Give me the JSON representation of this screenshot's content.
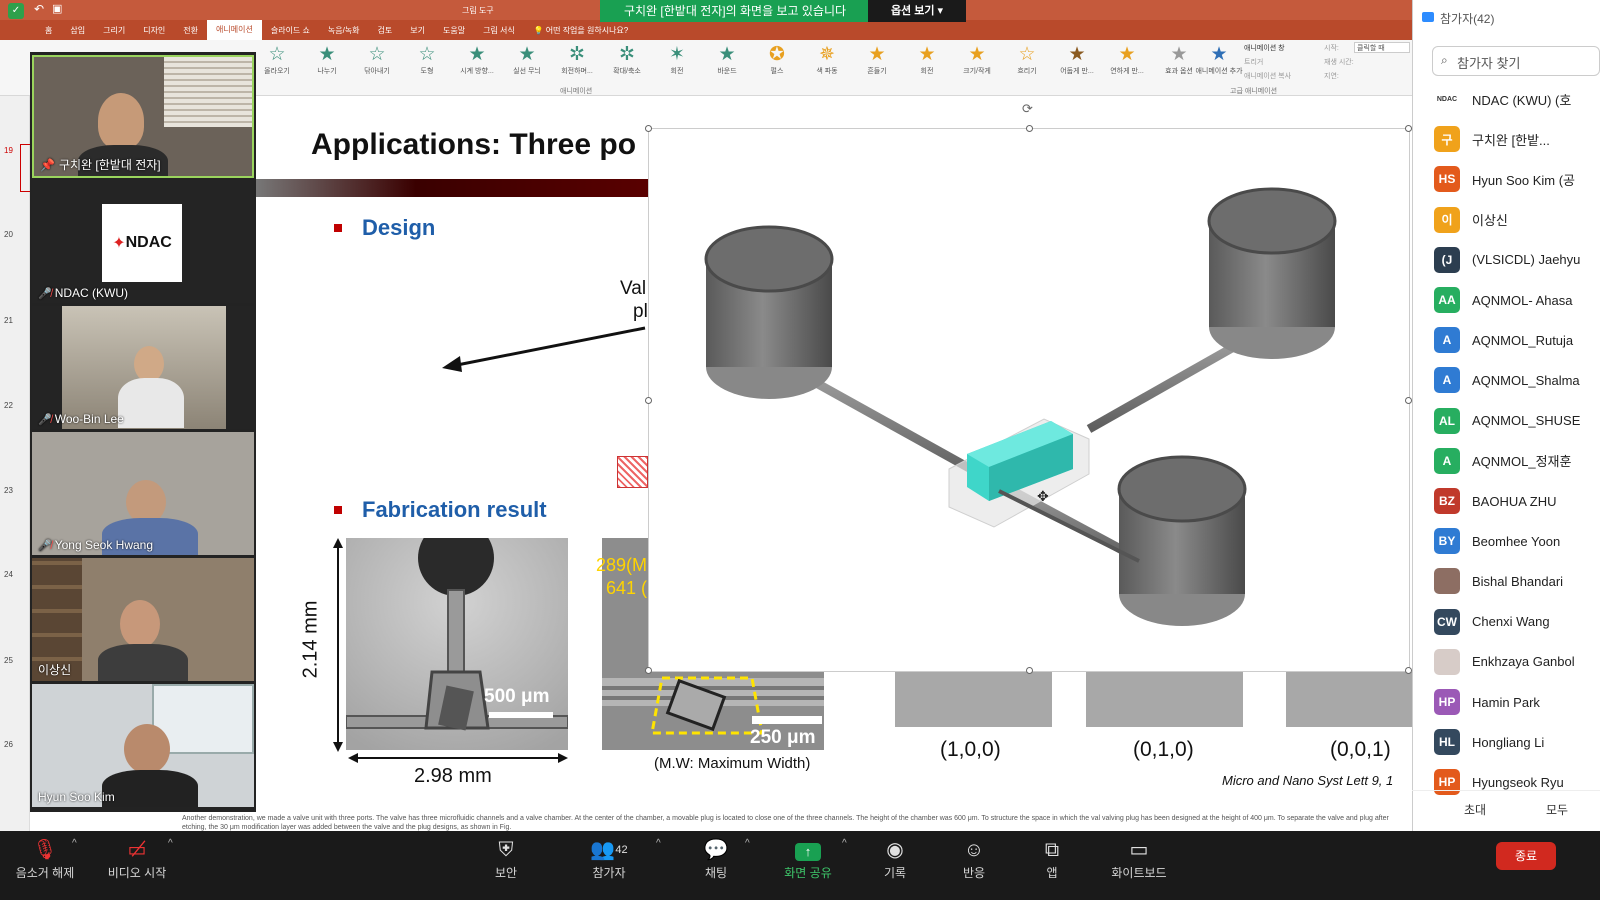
{
  "banner": {
    "sharing": "구치완 [한밭대 전자]의 화면을 보고 있습니다",
    "view_options": "옵션 보기"
  },
  "ribbon": {
    "tabs": [
      "홈",
      "삽입",
      "그리기",
      "디자인",
      "전환",
      "애니메이션",
      "슬라이드 쇼",
      "녹음/녹화",
      "검토",
      "보기",
      "도움말",
      "그림 서식"
    ],
    "active_tab": "애니메이션",
    "tell_me": "어떤 작업을 원하시나요?",
    "tools_label": "그림 도구",
    "effects": [
      "올라오기",
      "나누기",
      "닦아내기",
      "도형",
      "시계 방향...",
      "실선 무늬",
      "회전하며...",
      "확대/축소",
      "회전",
      "바운드",
      "펄스",
      "색 파동",
      "흔들기",
      "회전",
      "크기/작게",
      "흐리기",
      "어둡게 만...",
      "연하게 만...",
      "효과 옵션"
    ],
    "group_caption": "애니메이션",
    "advanced_caption": "고급 애니메이션",
    "add_anim": "애니메이션 추가",
    "anim_pane": "애니메이션 창",
    "trigger": "트리거",
    "anim_painter": "애니메이션 복사",
    "start": "시작:",
    "duration": "재생 시간:",
    "delay": "지연:",
    "on_click": "클릭할 때"
  },
  "thumbs": [
    "19",
    "20",
    "21",
    "22",
    "23",
    "24",
    "25",
    "26"
  ],
  "videos": [
    {
      "name": "구치완 [한밭대 전자]",
      "pinned": true,
      "muted": false
    },
    {
      "name": "NDAC (KWU)",
      "pinned": false,
      "muted": true,
      "logo": "NDAC"
    },
    {
      "name": "Woo-Bin Lee",
      "pinned": false,
      "muted": true
    },
    {
      "name": "Yong Seok Hwang",
      "pinned": false,
      "muted": true
    },
    {
      "name": "이상신",
      "pinned": false,
      "muted": false
    },
    {
      "name": "Hyun Soo Kim",
      "pinned": false,
      "muted": false
    }
  ],
  "slide": {
    "title": "Applications: Three po",
    "bullet_design": "Design",
    "bullet_fab": "Fabrication result",
    "design_label_1": "Val",
    "design_label_2": "pl",
    "dim_height": "2.14 mm",
    "dim_width": "2.98 mm",
    "scale1": "500 μm",
    "scale2": "250 μm",
    "yellow1": "289(M",
    "yellow2": "641 (",
    "mw": "(M.W: Maximum Width)",
    "coords": [
      "(1,0,0)",
      "(0,1,0)",
      "(0,0,1)"
    ],
    "citation": "Micro and Nano Syst Lett 9, 1",
    "cite_bold": "9",
    "notes": "Another demonstration, we made a valve unit with three ports. The valve has three microfluidic channels and a valve chamber. At the center of the chamber, a movable plug is located to close one of the three channels. The height of the chamber was 600 μm. To structure the space in which the val valving plug has been designed at the height of 400 μm. To separate the valve and plug after etching, the 30 μm modification layer was added between the valve and the plug designs, as shown in Fig."
  },
  "participants": {
    "title": "참가자(42)",
    "search_placeholder": "참가자 찾기",
    "list": [
      {
        "initials": "NDAC",
        "name": "NDAC (KWU) (호",
        "color": "#ffffff",
        "text": "#333333"
      },
      {
        "initials": "구",
        "name": "구치완 [한밭...",
        "color": "#f0a21b"
      },
      {
        "initials": "HS",
        "name": "Hyun Soo Kim (공",
        "color": "#e35a1c"
      },
      {
        "initials": "이",
        "name": "이상신",
        "color": "#f0a21b"
      },
      {
        "initials": "(J",
        "name": "(VLSICDL) Jaehyu",
        "color": "#2c3e50"
      },
      {
        "initials": "AA",
        "name": "AQNMOL- Ahasa",
        "color": "#27ae60"
      },
      {
        "initials": "A",
        "name": "AQNMOL_Rutuja",
        "color": "#2f7bd3"
      },
      {
        "initials": "A",
        "name": "AQNMOL_Shalma",
        "color": "#2f7bd3"
      },
      {
        "initials": "AL",
        "name": "AQNMOL_SHUSE",
        "color": "#27ae60"
      },
      {
        "initials": "A",
        "name": "AQNMOL_정재훈",
        "color": "#27ae60"
      },
      {
        "initials": "BZ",
        "name": "BAOHUA ZHU",
        "color": "#c0392b"
      },
      {
        "initials": "BY",
        "name": "Beomhee Yoon",
        "color": "#2f7bd3"
      },
      {
        "initials": "",
        "name": "Bishal Bhandari",
        "color": "#8d6e63",
        "photo": true
      },
      {
        "initials": "CW",
        "name": "Chenxi Wang",
        "color": "#34495e"
      },
      {
        "initials": "",
        "name": "Enkhzaya Ganbol",
        "color": "#d7ccc8",
        "photo": true
      },
      {
        "initials": "HP",
        "name": "Hamin Park",
        "color": "#9b59b6"
      },
      {
        "initials": "HL",
        "name": "Hongliang Li",
        "color": "#34495e"
      },
      {
        "initials": "HP",
        "name": "Hyungseok Ryu",
        "color": "#e35a1c"
      }
    ],
    "invite": "초대",
    "mute_all": "모두"
  },
  "toolbar": {
    "unmute": "음소거 해제",
    "video": "비디오 시작",
    "security": "보안",
    "participants": "참가자",
    "participants_count": "42",
    "chat": "채팅",
    "share": "화면 공유",
    "record": "기록",
    "reactions": "반응",
    "apps": "앱",
    "whiteboard": "화이트보드",
    "end": "종료"
  },
  "colors": {
    "share_green": "#19a052",
    "ribbon": "#b94a2b",
    "end_red": "#d1291f",
    "bullet_blue": "#1f5ea9",
    "plug_teal": "#3fd6c9"
  }
}
